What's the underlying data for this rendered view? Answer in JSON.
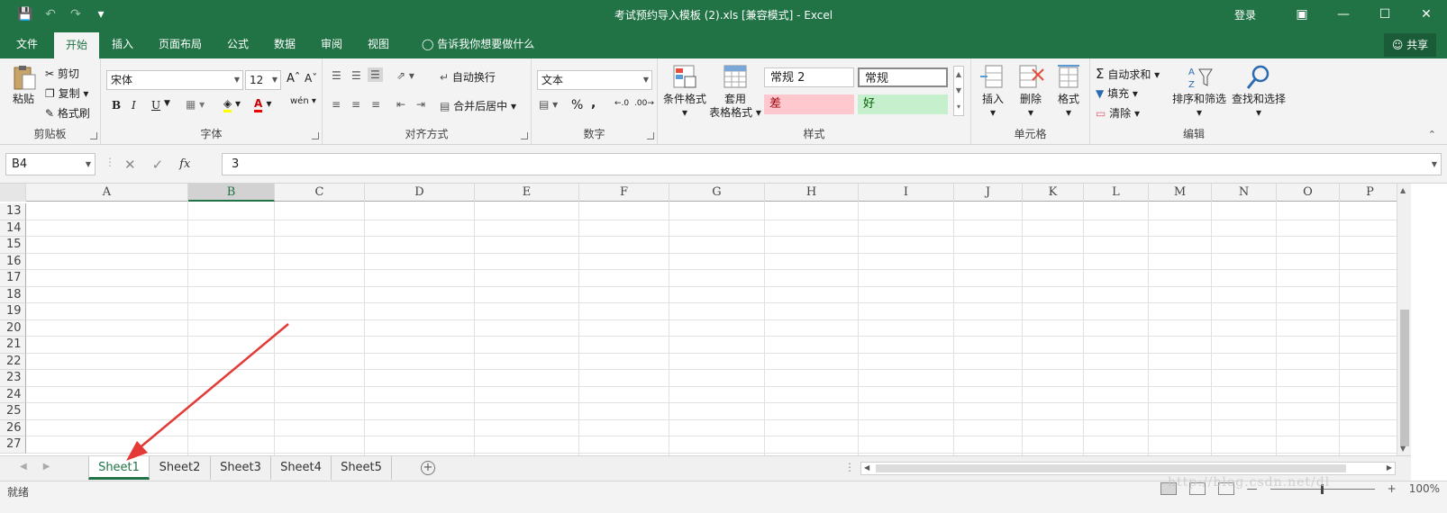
{
  "title": "考试预约导入模板 (2).xls  [兼容模式]  -  Excel",
  "window": {
    "login": "登录",
    "share": "共享"
  },
  "tabs": [
    "文件",
    "开始",
    "插入",
    "页面布局",
    "公式",
    "数据",
    "审阅",
    "视图"
  ],
  "tell_me": "告诉我你想要做什么",
  "clipboard": {
    "paste": "粘贴",
    "cut": "剪切",
    "copy": "复制",
    "format_painter": "格式刷",
    "label": "剪贴板"
  },
  "font": {
    "name": "宋体",
    "size": "12",
    "bold": "B",
    "italic": "I",
    "underline": "U",
    "label": "字体"
  },
  "alignment": {
    "wrap": "自动换行",
    "merge": "合并后居中",
    "label": "对齐方式"
  },
  "number": {
    "format": "文本",
    "percent": "%",
    "comma": ",",
    "label": "数字"
  },
  "styles": {
    "conditional": "条件格式",
    "table_format_1": "套用",
    "table_format_2": "表格格式",
    "normal2": "常规 2",
    "normal": "常规",
    "bad": "差",
    "good": "好",
    "label": "样式"
  },
  "cells": {
    "insert": "插入",
    "delete": "删除",
    "format": "格式",
    "label": "单元格"
  },
  "editing": {
    "autosum": "自动求和",
    "fill": "填充",
    "clear": "清除",
    "sort": "排序和筛选",
    "find": "查找和选择",
    "label": "编辑"
  },
  "formula_bar": {
    "name_box": "B4",
    "value": "3",
    "fx": "fx"
  },
  "columns": [
    "A",
    "B",
    "C",
    "D",
    "E",
    "F",
    "G",
    "H",
    "I",
    "J",
    "K",
    "L",
    "M",
    "N",
    "O",
    "P"
  ],
  "selected_column": "B",
  "rows": [
    "13",
    "14",
    "15",
    "16",
    "17",
    "18",
    "19",
    "20",
    "21",
    "22",
    "23",
    "24",
    "25",
    "26",
    "27"
  ],
  "sheets": [
    "Sheet1",
    "Sheet2",
    "Sheet3",
    "Sheet4",
    "Sheet5"
  ],
  "active_sheet": "Sheet1",
  "status": {
    "ready": "就绪",
    "zoom": "100%"
  },
  "watermark": "http://blog.csdn.net/dl"
}
